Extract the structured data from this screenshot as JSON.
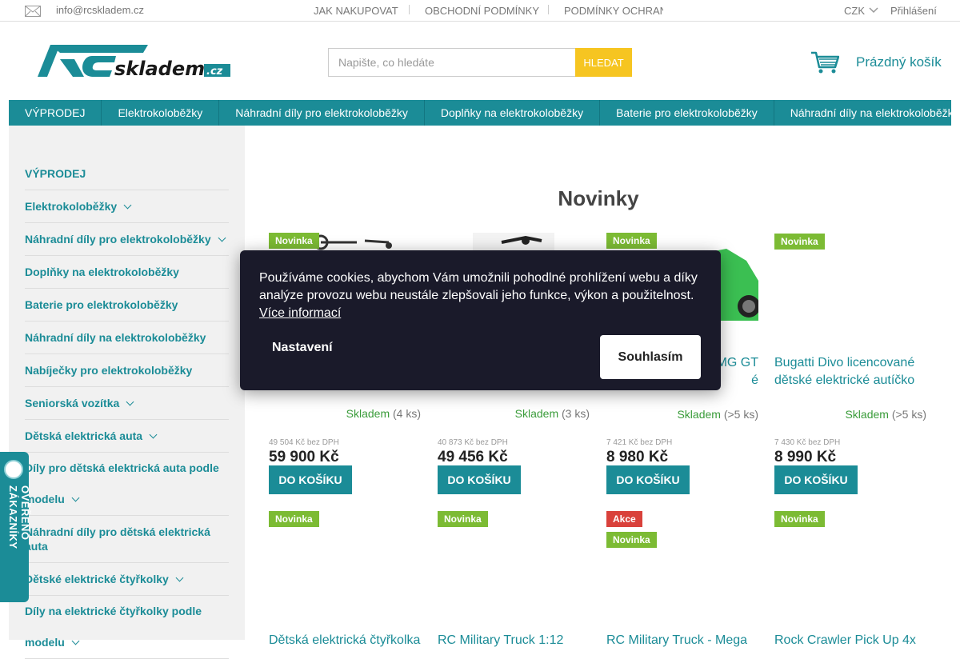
{
  "topbar": {
    "email": "info@rcskladem.cz",
    "links": [
      "JAK NAKUPOVAT",
      "OBCHODNÍ PODMÍNKY",
      "PODMÍNKY OCHRANY"
    ],
    "currency": "CZK",
    "login": "Přihlášení"
  },
  "header": {
    "logo_text": "RCskladem.cz",
    "search_placeholder": "Napište, co hledáte",
    "search_button": "HLEDAT",
    "cart_label": "Prázdný košík"
  },
  "nav": [
    "VÝPRODEJ",
    "Elektrokoloběžky",
    "Náhradní díly pro elektrokoloběžky",
    "Doplňky na elektrokoloběžky",
    "Baterie pro elektrokoloběžky",
    "Náhradní díly na elektrokoloběžky"
  ],
  "sidebar": [
    {
      "label": "VÝPRODEJ",
      "chevron": false
    },
    {
      "label": "Elektrokoloběžky",
      "chevron": true
    },
    {
      "label": "Náhradní díly pro elektrokoloběžky",
      "chevron": true
    },
    {
      "label": "Doplňky na elektrokoloběžky",
      "chevron": false
    },
    {
      "label": "Baterie pro elektrokoloběžky",
      "chevron": false
    },
    {
      "label": "Náhradní díly na elektrokoloběžky",
      "chevron": false
    },
    {
      "label": "Nabíječky pro elektrokoloběžky",
      "chevron": false
    },
    {
      "label": "Seniorská vozítka",
      "chevron": true
    },
    {
      "label": "Dětská elektrická auta",
      "chevron": true
    },
    {
      "label": "Díly pro dětská elektrická auta podle modelu",
      "chevron": true
    },
    {
      "label": "Náhradní díly pro dětská elektrická auta",
      "chevron": false
    },
    {
      "label": "Dětské elektrické čtyřkolky",
      "chevron": true
    },
    {
      "label": "Díly na elektrické čtyřkolky podle modelu",
      "chevron": true
    }
  ],
  "verified_badge": "OVĚŘENO ZÁKAZNÍKY",
  "main": {
    "title": "Novinky"
  },
  "products": [
    {
      "tags": [
        "Novinka"
      ],
      "name": "",
      "stock_status": "Skladem",
      "stock_count": "(4 ks)",
      "price_net": "49 504 Kč bez DPH",
      "price": "59 900 Kč",
      "buy": "DO KOŠÍKU"
    },
    {
      "tags": [],
      "name": "",
      "stock_status": "Skladem",
      "stock_count": "(3 ks)",
      "price_net": "40 873 Kč bez DPH",
      "price": "49 456 Kč",
      "buy": "DO KOŠÍKU"
    },
    {
      "tags": [
        "Novinka"
      ],
      "name": "MG GT\né",
      "stock_status": "Skladem",
      "stock_count": "(>5 ks)",
      "price_net": "7 421 Kč bez DPH",
      "price": "8 980 Kč",
      "buy": "DO KOŠÍKU"
    },
    {
      "tags": [
        "Novinka"
      ],
      "name": "Bugatti Divo licencované dětské elektrické autíčko",
      "stock_status": "Skladem",
      "stock_count": "(>5 ks)",
      "price_net": "7 430 Kč bez DPH",
      "price": "8 990 Kč",
      "buy": "DO KOŠÍKU"
    }
  ],
  "products_row2": [
    {
      "tags": [
        "Novinka"
      ],
      "name": "Dětská elektrická čtyřkolka"
    },
    {
      "tags": [
        "Novinka"
      ],
      "name": "RC Military Truck 1:12"
    },
    {
      "tags": [
        "Akce",
        "Novinka"
      ],
      "name": "RC Military Truck - Mega"
    },
    {
      "tags": [
        "Novinka"
      ],
      "name": "Rock Crawler Pick Up 4x"
    }
  ],
  "cookie": {
    "message": "Používáme cookies, abychom Vám umožnili pohodlné prohlížení webu a díky analýze provozu webu neustále zlepšovali jeho funkce, výkon a použitelnost.",
    "more": "Více informací",
    "settings": "Nastavení",
    "agree": "Souhlasím"
  },
  "colors": {
    "accent": "#1b8c97",
    "search_button": "#f6c521",
    "tag_new": "#7cbb34",
    "tag_sale": "#d9413b"
  }
}
